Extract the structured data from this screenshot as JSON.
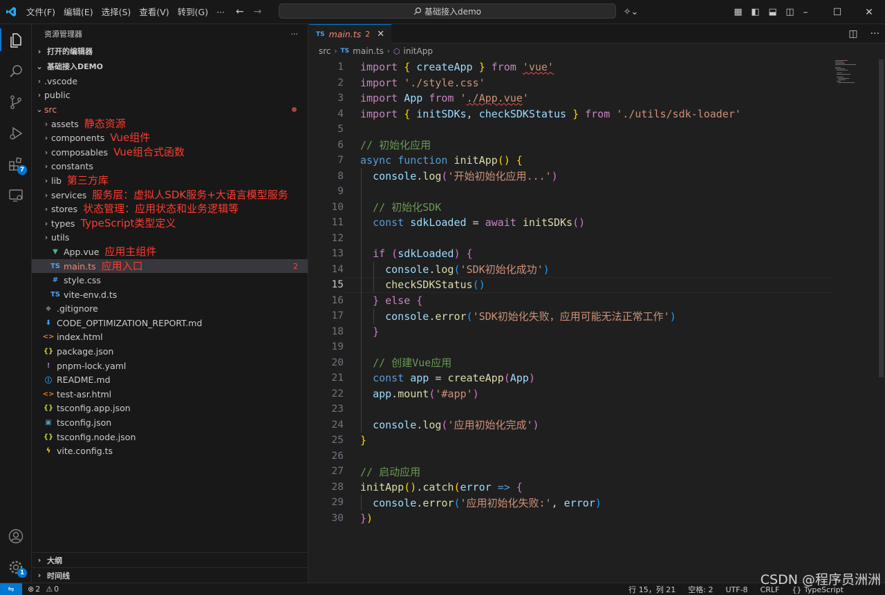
{
  "titlebar": {
    "menu": [
      "文件(F)",
      "编辑(E)",
      "选择(S)",
      "查看(V)",
      "转到(G)",
      "···"
    ],
    "search_text": "基础接入demo"
  },
  "activity": {
    "extensions_badge": "7",
    "settings_badge": "1"
  },
  "explorer": {
    "header": "资源管理器",
    "open_editors": "打开的编辑器",
    "project": "基础接入DEMO",
    "items": [
      {
        "name": ".vscode",
        "type": "folder",
        "indent": 1
      },
      {
        "name": "public",
        "type": "folder",
        "indent": 1
      },
      {
        "name": "src",
        "type": "folder-open",
        "indent": 1,
        "color": "#f48771"
      },
      {
        "name": "assets",
        "type": "folder",
        "indent": 2,
        "note": "静态资源"
      },
      {
        "name": "components",
        "type": "folder",
        "indent": 2,
        "note": "Vue组件"
      },
      {
        "name": "composables",
        "type": "folder",
        "indent": 2,
        "note": "Vue组合式函数"
      },
      {
        "name": "constants",
        "type": "folder",
        "indent": 2
      },
      {
        "name": "lib",
        "type": "folder",
        "indent": 2,
        "note": "第三方库"
      },
      {
        "name": "services",
        "type": "folder",
        "indent": 2,
        "note": "服务层：虚拟人SDK服务+大语言模型服务"
      },
      {
        "name": "stores",
        "type": "folder",
        "indent": 2,
        "note": "状态管理：应用状态和业务逻辑等"
      },
      {
        "name": "types",
        "type": "folder",
        "indent": 2,
        "note": "TypeScript类型定义"
      },
      {
        "name": "utils",
        "type": "folder",
        "indent": 2
      },
      {
        "name": "App.vue",
        "type": "vue",
        "indent": 2,
        "note": "应用主组件"
      },
      {
        "name": "main.ts",
        "type": "ts",
        "indent": 2,
        "note": "应用入口",
        "badge": "2",
        "selected": true,
        "color": "#f48771"
      },
      {
        "name": "style.css",
        "type": "css",
        "indent": 2
      },
      {
        "name": "vite-env.d.ts",
        "type": "ts",
        "indent": 2
      },
      {
        "name": ".gitignore",
        "type": "git",
        "indent": 1
      },
      {
        "name": "CODE_OPTIMIZATION_REPORT.md",
        "type": "md-down",
        "indent": 1
      },
      {
        "name": "index.html",
        "type": "html",
        "indent": 1
      },
      {
        "name": "package.json",
        "type": "json",
        "indent": 1
      },
      {
        "name": "pnpm-lock.yaml",
        "type": "yaml",
        "indent": 1
      },
      {
        "name": "README.md",
        "type": "info",
        "indent": 1
      },
      {
        "name": "test-asr.html",
        "type": "html",
        "indent": 1
      },
      {
        "name": "tsconfig.app.json",
        "type": "json",
        "indent": 1
      },
      {
        "name": "tsconfig.json",
        "type": "tsjson",
        "indent": 1
      },
      {
        "name": "tsconfig.node.json",
        "type": "json",
        "indent": 1
      },
      {
        "name": "vite.config.ts",
        "type": "vite",
        "indent": 1
      }
    ],
    "outline": "大纲",
    "timeline": "时间线"
  },
  "editor": {
    "tab_label": "main.ts",
    "tab_badge": "2",
    "file_lang": "TS",
    "breadcrumb": [
      "src",
      "main.ts",
      "initApp"
    ],
    "current_line": 15,
    "lines": [
      [
        [
          "kw2",
          "import"
        ],
        [
          "plain",
          " "
        ],
        [
          "b1",
          "{"
        ],
        [
          "plain",
          " "
        ],
        [
          "var",
          "createApp"
        ],
        [
          "plain",
          " "
        ],
        [
          "b1",
          "}"
        ],
        [
          "plain",
          " "
        ],
        [
          "kw2",
          "from"
        ],
        [
          "plain",
          " "
        ],
        [
          "str squig",
          "'vue'"
        ]
      ],
      [
        [
          "kw2",
          "import"
        ],
        [
          "plain",
          " "
        ],
        [
          "str",
          "'./style.css'"
        ]
      ],
      [
        [
          "kw2",
          "import"
        ],
        [
          "plain",
          " "
        ],
        [
          "var",
          "App"
        ],
        [
          "plain",
          " "
        ],
        [
          "kw2",
          "from"
        ],
        [
          "plain",
          " "
        ],
        [
          "str",
          "'"
        ],
        [
          "str squig",
          "./App.vue"
        ],
        [
          "str",
          "'"
        ]
      ],
      [
        [
          "kw2",
          "import"
        ],
        [
          "plain",
          " "
        ],
        [
          "b1",
          "{"
        ],
        [
          "plain",
          " "
        ],
        [
          "var",
          "initSDKs"
        ],
        [
          "plain",
          ", "
        ],
        [
          "var",
          "checkSDKStatus"
        ],
        [
          "plain",
          " "
        ],
        [
          "b1",
          "}"
        ],
        [
          "plain",
          " "
        ],
        [
          "kw2",
          "from"
        ],
        [
          "plain",
          " "
        ],
        [
          "str",
          "'./utils/sdk-loader'"
        ]
      ],
      [],
      [
        [
          "cmt",
          "// 初始化应用"
        ]
      ],
      [
        [
          "kw",
          "async"
        ],
        [
          "plain",
          " "
        ],
        [
          "kw",
          "function"
        ],
        [
          "plain",
          " "
        ],
        [
          "fn",
          "initApp"
        ],
        [
          "b1",
          "()"
        ],
        [
          "plain",
          " "
        ],
        [
          "b1",
          "{"
        ]
      ],
      [
        [
          "plain",
          "  "
        ],
        [
          "var",
          "console"
        ],
        [
          "plain",
          "."
        ],
        [
          "fn",
          "log"
        ],
        [
          "b2",
          "("
        ],
        [
          "str",
          "'开始初始化应用...'"
        ],
        [
          "b2",
          ")"
        ]
      ],
      [],
      [
        [
          "plain",
          "  "
        ],
        [
          "cmt",
          "// 初始化SDK"
        ]
      ],
      [
        [
          "plain",
          "  "
        ],
        [
          "kw",
          "const"
        ],
        [
          "plain",
          " "
        ],
        [
          "var",
          "sdkLoaded"
        ],
        [
          "plain",
          " = "
        ],
        [
          "kw2",
          "await"
        ],
        [
          "plain",
          " "
        ],
        [
          "fn",
          "initSDKs"
        ],
        [
          "b2",
          "()"
        ]
      ],
      [],
      [
        [
          "plain",
          "  "
        ],
        [
          "kw2",
          "if"
        ],
        [
          "plain",
          " "
        ],
        [
          "b2",
          "("
        ],
        [
          "var",
          "sdkLoaded"
        ],
        [
          "b2",
          ")"
        ],
        [
          "plain",
          " "
        ],
        [
          "b2",
          "{"
        ]
      ],
      [
        [
          "plain",
          "    "
        ],
        [
          "var",
          "console"
        ],
        [
          "plain",
          "."
        ],
        [
          "fn",
          "log"
        ],
        [
          "b3",
          "("
        ],
        [
          "str",
          "'SDK初始化成功'"
        ],
        [
          "b3",
          ")"
        ]
      ],
      [
        [
          "plain",
          "    "
        ],
        [
          "fn",
          "checkSDKStatus"
        ],
        [
          "b3",
          "()"
        ]
      ],
      [
        [
          "plain",
          "  "
        ],
        [
          "b2",
          "}"
        ],
        [
          "plain",
          " "
        ],
        [
          "kw2",
          "else"
        ],
        [
          "plain",
          " "
        ],
        [
          "b2",
          "{"
        ]
      ],
      [
        [
          "plain",
          "    "
        ],
        [
          "var",
          "console"
        ],
        [
          "plain",
          "."
        ],
        [
          "fn",
          "error"
        ],
        [
          "b3",
          "("
        ],
        [
          "str",
          "'SDK初始化失败，应用可能无法正常工作'"
        ],
        [
          "b3",
          ")"
        ]
      ],
      [
        [
          "plain",
          "  "
        ],
        [
          "b2",
          "}"
        ]
      ],
      [],
      [
        [
          "plain",
          "  "
        ],
        [
          "cmt",
          "// 创建Vue应用"
        ]
      ],
      [
        [
          "plain",
          "  "
        ],
        [
          "kw",
          "const"
        ],
        [
          "plain",
          " "
        ],
        [
          "var",
          "app"
        ],
        [
          "plain",
          " = "
        ],
        [
          "fn",
          "createApp"
        ],
        [
          "b2",
          "("
        ],
        [
          "var",
          "App"
        ],
        [
          "b2",
          ")"
        ]
      ],
      [
        [
          "plain",
          "  "
        ],
        [
          "var",
          "app"
        ],
        [
          "plain",
          "."
        ],
        [
          "fn",
          "mount"
        ],
        [
          "b2",
          "("
        ],
        [
          "str",
          "'#app'"
        ],
        [
          "b2",
          ")"
        ]
      ],
      [],
      [
        [
          "plain",
          "  "
        ],
        [
          "var",
          "console"
        ],
        [
          "plain",
          "."
        ],
        [
          "fn",
          "log"
        ],
        [
          "b2",
          "("
        ],
        [
          "str",
          "'应用初始化完成'"
        ],
        [
          "b2",
          ")"
        ]
      ],
      [
        [
          "b1",
          "}"
        ]
      ],
      [],
      [
        [
          "cmt",
          "// 启动应用"
        ]
      ],
      [
        [
          "fn",
          "initApp"
        ],
        [
          "b1",
          "()"
        ],
        [
          "plain",
          "."
        ],
        [
          "fn",
          "catch"
        ],
        [
          "b1",
          "("
        ],
        [
          "var",
          "error"
        ],
        [
          "plain",
          " "
        ],
        [
          "kw",
          "=>"
        ],
        [
          "plain",
          " "
        ],
        [
          "b2",
          "{"
        ]
      ],
      [
        [
          "plain",
          "  "
        ],
        [
          "var",
          "console"
        ],
        [
          "plain",
          "."
        ],
        [
          "fn",
          "error"
        ],
        [
          "b3",
          "("
        ],
        [
          "str",
          "'应用初始化失败:'"
        ],
        [
          "plain",
          ", "
        ],
        [
          "var",
          "error"
        ],
        [
          "b3",
          ")"
        ]
      ],
      [
        [
          "b2",
          "}"
        ],
        [
          "b1",
          ")"
        ]
      ]
    ]
  },
  "status": {
    "remote": "⇋",
    "errors": "2",
    "warnings": "0",
    "position": "行 15，列 21",
    "indent": "空格: 2",
    "encoding": "UTF-8",
    "eol": "CRLF",
    "language": "TypeScript"
  },
  "watermark": "CSDN @程序员洲洲",
  "colors": {
    "accent": "#0078d4",
    "annotation": "#ff3b30",
    "error": "#f14c4c"
  }
}
